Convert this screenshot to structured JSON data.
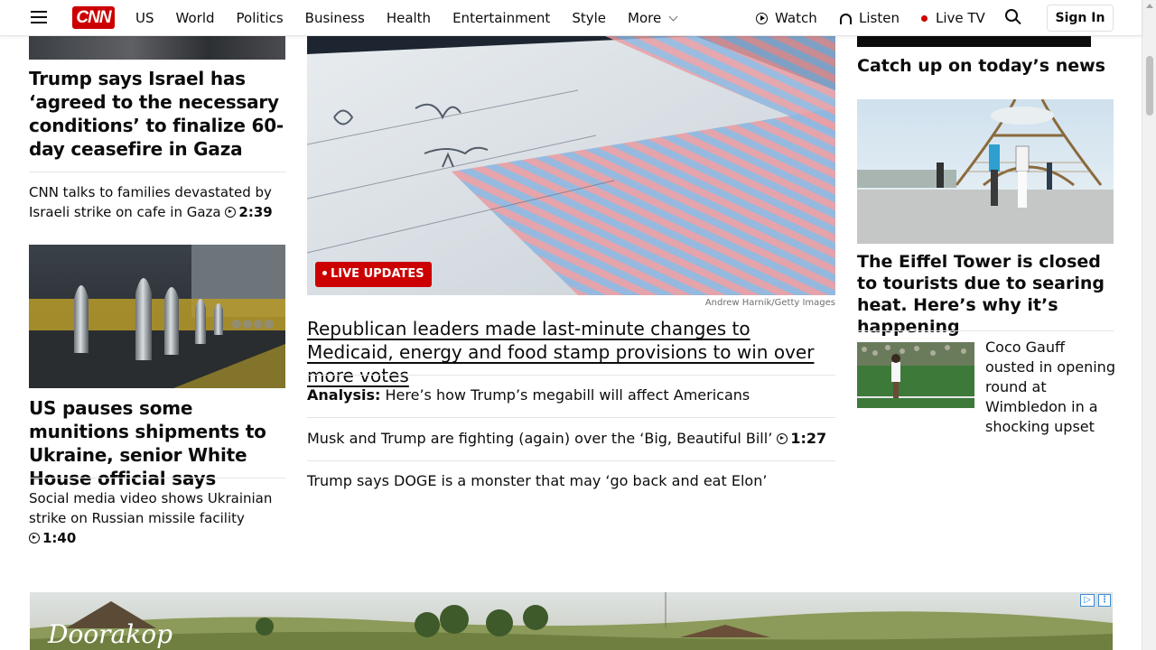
{
  "header": {
    "logo": "CNN",
    "nav": [
      "US",
      "World",
      "Politics",
      "Business",
      "Health",
      "Entertainment",
      "Style"
    ],
    "more_label": "More",
    "watch_label": "Watch",
    "listen_label": "Listen",
    "live_tv_label": "Live TV",
    "sign_in_label": "Sign In"
  },
  "left": {
    "story1_headline": "Trump says Israel has ‘agreed to the necessary conditions’ to finalize 60-day ceasefire in Gaza",
    "video1_text": "CNN talks to families devastated by Israeli strike on cafe in Gaza",
    "video1_duration": "2:39",
    "story2_headline": "US pauses some munitions shipments to Ukraine, senior White House official says",
    "video2_text": "Social media video shows Ukrainian strike on Russian missile facility",
    "video2_duration": "1:40"
  },
  "center": {
    "live_badge": "LIVE UPDATES",
    "image_credit": "Andrew Harnik/Getty Images",
    "headline": "Republican leaders made last-minute changes to Medicaid, energy and food stamp provisions to win over more votes",
    "item1_prefix": "Analysis:",
    "item1_text": "Here’s how Trump’s megabill will affect Americans",
    "item2_text": "Musk and Trump are fighting (again) over the ‘Big, Beautiful Bill’",
    "item2_duration": "1:27",
    "item3_text": "Trump says DOGE is a monster that may ‘go back and eat Elon’"
  },
  "right": {
    "catch_up": "Catch up on today’s news",
    "story1_headline": "The Eiffel Tower is closed to tourists due to searing heat. Here’s why it’s happening",
    "story2_headline": "Coco Gauff ousted in opening round at Wimbledon in a shocking upset"
  },
  "ad": {
    "logo_text": "Doorakop"
  },
  "colors": {
    "brand_red": "#cc0000",
    "divider": "#e6e6e6"
  }
}
